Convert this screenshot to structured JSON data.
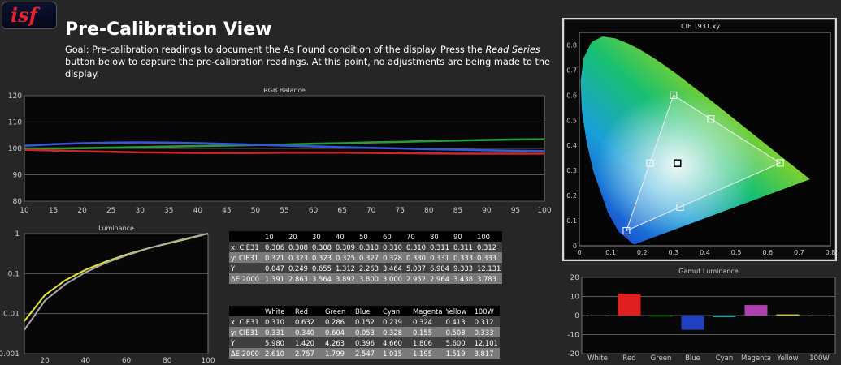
{
  "logo": "isf",
  "title": "Pre-Calibration View",
  "goal": {
    "prefix": "Goal: Pre-calibration readings to document the As Found condition of the display. Press the ",
    "emphasis": "Read Series",
    "suffix": " button below to capture the pre-calibration readings. At this point, no adjustments are being made to the display."
  },
  "rgb_balance": {
    "chart_data": {
      "type": "line",
      "title": "RGB Balance",
      "x": [
        10,
        15,
        20,
        25,
        30,
        35,
        40,
        45,
        50,
        55,
        60,
        65,
        70,
        75,
        80,
        85,
        90,
        95,
        100
      ],
      "ylim": [
        80,
        120
      ],
      "xlim": [
        10,
        100
      ],
      "y_ticks": [
        80,
        90,
        100,
        110,
        120
      ],
      "series": [
        {
          "color": "#2b9a3a",
          "values": [
            100.0,
            100.0,
            100.1,
            100.3,
            100.5,
            100.7,
            100.9,
            101.1,
            101.3,
            101.5,
            101.8,
            102.0,
            102.3,
            102.5,
            102.8,
            103.0,
            103.2,
            103.4,
            103.5
          ]
        },
        {
          "color": "#3756d8",
          "values": [
            101.0,
            101.6,
            102.0,
            102.2,
            102.3,
            102.2,
            102.0,
            101.7,
            101.4,
            101.1,
            100.8,
            100.5,
            100.2,
            100.0,
            99.7,
            99.5,
            99.3,
            99.1,
            99.0
          ]
        },
        {
          "color": "#c6282b",
          "values": [
            99.5,
            99.2,
            98.9,
            98.7,
            98.5,
            98.4,
            98.3,
            98.3,
            98.3,
            98.4,
            98.4,
            98.4,
            98.3,
            98.2,
            98.1,
            98.0,
            98.0,
            98.0,
            98.0
          ]
        }
      ]
    }
  },
  "luminance": {
    "chart_data": {
      "type": "line",
      "title": "Luminance",
      "x": [
        10,
        20,
        30,
        40,
        50,
        60,
        70,
        80,
        90,
        100
      ],
      "y_scale": "log",
      "ylim": [
        0.001,
        1
      ],
      "y_ticks": [
        "1",
        "0.1",
        "0.01",
        "0.001"
      ],
      "x_ticks": [
        20,
        40,
        60,
        80,
        100
      ],
      "series": [
        {
          "color": "#e6e630",
          "values": [
            0.0065,
            0.029,
            0.068,
            0.125,
            0.2,
            0.3,
            0.42,
            0.56,
            0.74,
            1.0
          ]
        },
        {
          "color": "#aaaaaa",
          "values": [
            0.0039,
            0.021,
            0.054,
            0.108,
            0.187,
            0.285,
            0.415,
            0.577,
            0.768,
            1.0
          ]
        }
      ]
    }
  },
  "gray_table": {
    "chart_data": {
      "type": "table",
      "columns": [
        "",
        "10",
        "20",
        "30",
        "40",
        "50",
        "60",
        "70",
        "80",
        "90",
        "100"
      ],
      "rows": [
        [
          "x: CIE31",
          "0.306",
          "0.308",
          "0.308",
          "0.309",
          "0.310",
          "0.310",
          "0.310",
          "0.311",
          "0.311",
          "0.312"
        ],
        [
          "y: CIE31",
          "0.321",
          "0.323",
          "0.323",
          "0.325",
          "0.327",
          "0.328",
          "0.330",
          "0.331",
          "0.333",
          "0.333"
        ],
        [
          "Y",
          "0.047",
          "0.249",
          "0.655",
          "1.312",
          "2.263",
          "3.464",
          "5.037",
          "6.984",
          "9.333",
          "12.131"
        ],
        [
          "ΔE 2000",
          "1.391",
          "2.863",
          "3.564",
          "3.892",
          "3.800",
          "3.000",
          "2.952",
          "2.964",
          "3.438",
          "3.783"
        ]
      ]
    }
  },
  "color_table": {
    "chart_data": {
      "type": "table",
      "columns": [
        "",
        "White",
        "Red",
        "Green",
        "Blue",
        "Cyan",
        "Magenta",
        "Yellow",
        "100W"
      ],
      "rows": [
        [
          "x: CIE31",
          "0.310",
          "0.632",
          "0.286",
          "0.152",
          "0.219",
          "0.324",
          "0.413",
          "0.312"
        ],
        [
          "y: CIE31",
          "0.331",
          "0.340",
          "0.604",
          "0.053",
          "0.328",
          "0.155",
          "0.508",
          "0.333"
        ],
        [
          "Y",
          "5.980",
          "1.420",
          "4.263",
          "0.396",
          "4.660",
          "1.806",
          "5.600",
          "12.101"
        ],
        [
          "ΔE 2000",
          "2.610",
          "2.757",
          "1.799",
          "2.547",
          "1.015",
          "1.195",
          "1.519",
          "3.817"
        ]
      ]
    }
  },
  "cie": {
    "chart_data": {
      "type": "scatter",
      "title": "CIE 1931 xy",
      "xlim": [
        0,
        0.8
      ],
      "ylim": [
        0,
        0.85
      ],
      "x_ticks": [
        "0",
        "0.1",
        "0.2",
        "0.3",
        "0.4",
        "0.5",
        "0.6",
        "0.7",
        "0.8"
      ],
      "y_ticks": [
        "0",
        "0.1",
        "0.2",
        "0.3",
        "0.4",
        "0.5",
        "0.6",
        "0.7",
        "0.8"
      ],
      "gamut_targets": [
        [
          0.64,
          0.33
        ],
        [
          0.3,
          0.6
        ],
        [
          0.15,
          0.06
        ]
      ],
      "secondary_targets": [
        [
          0.225,
          0.329
        ],
        [
          0.321,
          0.154
        ],
        [
          0.419,
          0.505
        ]
      ],
      "white_target": [
        0.3127,
        0.329
      ]
    }
  },
  "gamut_luminance": {
    "chart_data": {
      "type": "bar",
      "title": "Gamut Luminance",
      "categories": [
        "White",
        "Red",
        "Green",
        "Blue",
        "Cyan",
        "Magenta",
        "Yellow",
        "100W"
      ],
      "values": [
        0,
        11.5,
        -0.5,
        -7.5,
        -0.8,
        5.5,
        0.6,
        0
      ],
      "colors": [
        "#dddddd",
        "#e02020",
        "#20a020",
        "#2040c0",
        "#20b0b0",
        "#b040b0",
        "#d0d020",
        "#dddddd"
      ],
      "ylim": [
        -20,
        20
      ],
      "y_ticks": [
        "20",
        "10",
        "0",
        "-10",
        "-20"
      ]
    }
  }
}
